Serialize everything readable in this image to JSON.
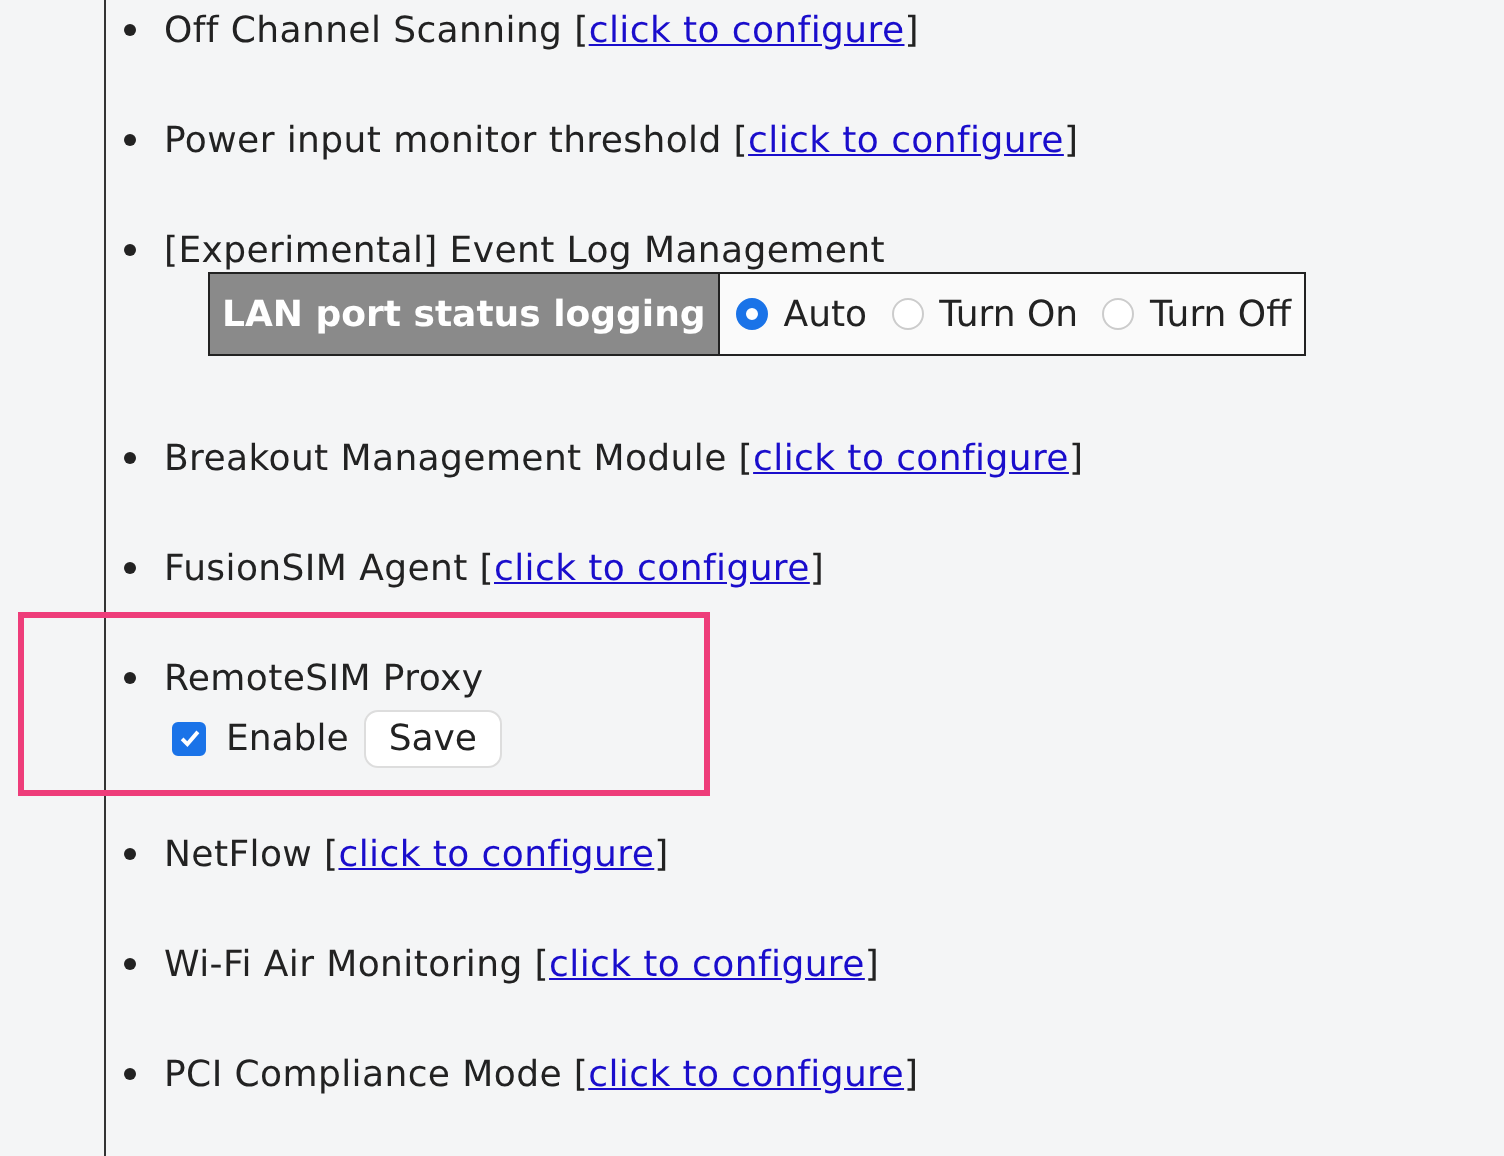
{
  "items": [
    {
      "kind": "link",
      "label": "Off Channel Scanning [",
      "link": "click to configure",
      "after": "]"
    },
    {
      "kind": "link",
      "label": "Power input monitor threshold [",
      "link": "click to configure",
      "after": "]"
    },
    {
      "kind": "radio",
      "label": "[Experimental] Event Log Management",
      "setting": "LAN port status logging",
      "options": [
        {
          "label": "Auto",
          "selected": true
        },
        {
          "label": "Turn On",
          "selected": false
        },
        {
          "label": "Turn Off",
          "selected": false
        }
      ]
    },
    {
      "kind": "link",
      "label": "Breakout Management Module [",
      "link": "click to configure",
      "after": "]"
    },
    {
      "kind": "link",
      "label": "FusionSIM Agent [",
      "link": "click to configure",
      "after": "]"
    },
    {
      "kind": "checkbox",
      "label": "RemoteSIM Proxy",
      "highlighted": true,
      "checkbox": {
        "label": "Enable",
        "checked": true
      },
      "button": "Save"
    },
    {
      "kind": "link",
      "label": "NetFlow [",
      "link": "click to configure",
      "after": "]"
    },
    {
      "kind": "link",
      "label": "Wi-Fi Air Monitoring [",
      "link": "click to configure",
      "after": "]"
    },
    {
      "kind": "link",
      "label": "PCI Compliance Mode [",
      "link": "click to configure",
      "after": "]"
    }
  ]
}
